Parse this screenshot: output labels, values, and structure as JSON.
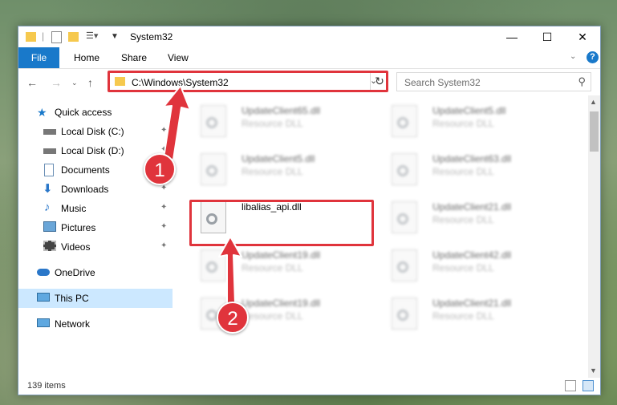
{
  "window": {
    "title": "System32",
    "controls": {
      "minimize": "—",
      "maximize": "☐",
      "close": "✕"
    }
  },
  "ribbon": {
    "tabs": [
      {
        "label": "File",
        "active": true
      },
      {
        "label": "Home"
      },
      {
        "label": "Share"
      },
      {
        "label": "View"
      }
    ],
    "help_label": "?"
  },
  "address": {
    "path": "C:\\Windows\\System32",
    "search_placeholder": "Search System32"
  },
  "sidebar": {
    "items": [
      {
        "label": "Quick access",
        "icon": "star-icon",
        "pinned": false
      },
      {
        "label": "Local Disk (C:)",
        "icon": "drive-icon",
        "pinned": true
      },
      {
        "label": "Local Disk (D:)",
        "icon": "drive-icon",
        "pinned": true
      },
      {
        "label": "Documents",
        "icon": "documents-icon",
        "pinned": true
      },
      {
        "label": "Downloads",
        "icon": "downloads-icon",
        "pinned": true
      },
      {
        "label": "Music",
        "icon": "music-icon",
        "pinned": true
      },
      {
        "label": "Pictures",
        "icon": "pictures-icon",
        "pinned": true
      },
      {
        "label": "Videos",
        "icon": "videos-icon",
        "pinned": true
      },
      {
        "label": "OneDrive",
        "icon": "cloud-icon",
        "pinned": false
      },
      {
        "label": "This PC",
        "icon": "computer-icon",
        "selected": true
      },
      {
        "label": "Network",
        "icon": "network-icon"
      }
    ]
  },
  "files": [
    {
      "name": "UpdateClient65.dll",
      "type": "Resource DLL",
      "blurred": true
    },
    {
      "name": "UpdateClient5.dll",
      "type": "Resource DLL",
      "blurred": true
    },
    {
      "name": "UpdateClient5.dll",
      "type": "Resource DLL",
      "blurred": true
    },
    {
      "name": "UpdateClient63.dll",
      "type": "Resource DLL",
      "blurred": true
    },
    {
      "name": "libalias_api.dll",
      "type": "",
      "blurred": false
    },
    {
      "name": "UpdateClient21.dll",
      "type": "Resource DLL",
      "blurred": true
    },
    {
      "name": "UpdateClient19.dll",
      "type": "Resource DLL",
      "blurred": true
    },
    {
      "name": "UpdateClient42.dll",
      "type": "Resource DLL",
      "blurred": true
    },
    {
      "name": "UpdateClient19.dll",
      "type": "Resource DLL",
      "blurred": true
    },
    {
      "name": "UpdateClient21.dll",
      "type": "Resource DLL",
      "blurred": true
    }
  ],
  "status": {
    "item_count": "139 items"
  },
  "callouts": [
    "1",
    "2"
  ],
  "colors": {
    "accent": "#1979ca",
    "highlight": "#e0343c",
    "selected": "#cce8ff"
  }
}
